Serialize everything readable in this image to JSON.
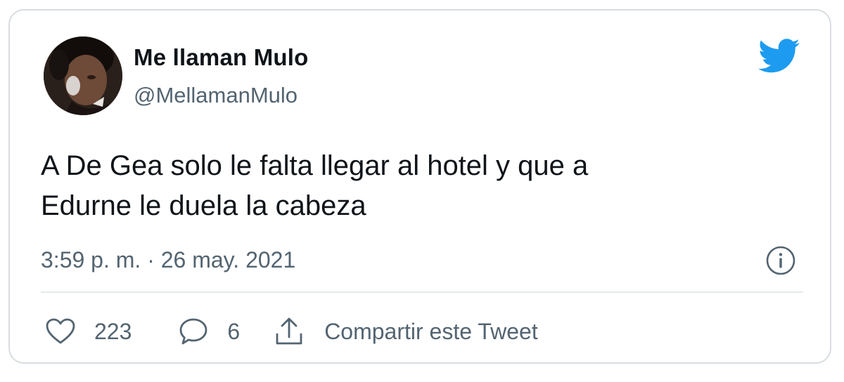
{
  "tweet": {
    "author": {
      "display_name": "Me llaman Mulo",
      "handle": "@MellamanMulo"
    },
    "text_lines": [
      "A De Gea solo le falta llegar al hotel y que a",
      "Edurne le duela la cabeza"
    ],
    "timestamp": "3:59 p. m. · 26 may. 2021",
    "likes": "223",
    "replies": "6",
    "share_label": "Compartir este Tweet"
  },
  "icons": {
    "brand": "twitter-bird-icon",
    "info": "info-icon",
    "like": "heart-icon",
    "reply": "speech-bubble-icon",
    "share": "share-icon"
  },
  "colors": {
    "brand_blue": "#1d9bf0",
    "text_primary": "#0f1419",
    "text_secondary": "#536471",
    "border": "#d9dde1"
  }
}
